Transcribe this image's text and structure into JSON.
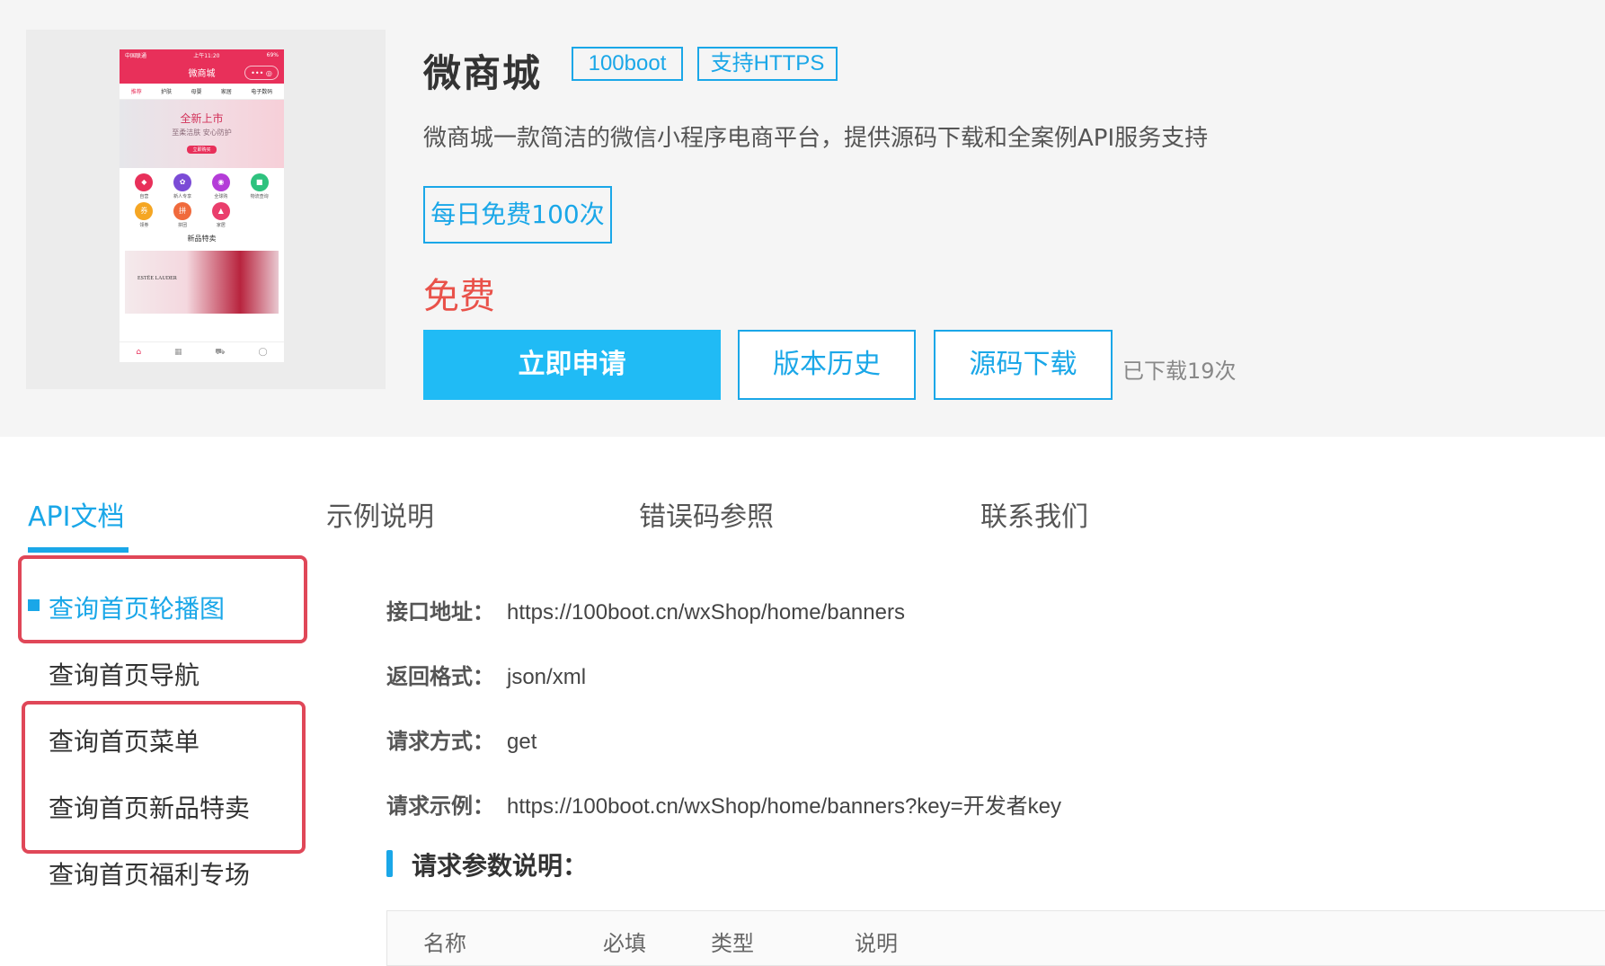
{
  "app": {
    "title": "微商城",
    "tags": [
      "100boot",
      "支持HTTPS"
    ],
    "description": "微商城一款简洁的微信小程序电商平台，提供源码下载和全案例API服务支持",
    "quota": "每日免费100次",
    "price": "免费",
    "download_count": "已下载19次"
  },
  "buttons": {
    "apply": "立即申请",
    "history": "版本历史",
    "download": "源码下载"
  },
  "thumbnail": {
    "status_left": "中国联通",
    "status_time": "上午11:20",
    "status_right": "69%",
    "bar_title": "微商城",
    "capsule": "••• ◎",
    "tabs": [
      "推荐",
      "护肤",
      "母婴",
      "家居",
      "电子数码"
    ],
    "banner_title": "全新上市",
    "banner_sub": "至柔洁肤 安心防护",
    "banner_btn": "立即购买",
    "icons": [
      {
        "label": "自营",
        "glyph": "◆",
        "color": "#e8305a"
      },
      {
        "label": "新人专享",
        "glyph": "✿",
        "color": "#7b4bd6"
      },
      {
        "label": "全球购",
        "glyph": "◉",
        "color": "#b43cd8"
      },
      {
        "label": "物流查询",
        "glyph": "■",
        "color": "#2ec27e"
      },
      {
        "label": "领券",
        "glyph": "券",
        "color": "#f5a623"
      },
      {
        "label": "拼团",
        "glyph": "拼",
        "color": "#f06a3c"
      },
      {
        "label": "家居",
        "glyph": "▲",
        "color": "#ea3e6c"
      }
    ],
    "section": "新品特卖",
    "promo_brand": "ESTĒE LAUDER",
    "nav": [
      "⌂",
      "▦",
      "⛟",
      "◯"
    ]
  },
  "tabs": [
    "API文档",
    "示例说明",
    "错误码参照",
    "联系我们"
  ],
  "sidebar": {
    "items": [
      "查询首页轮播图",
      "查询首页导航",
      "查询首页菜单",
      "查询首页新品特卖",
      "查询首页福利专场"
    ]
  },
  "api": {
    "rows": [
      {
        "label": "接口地址：",
        "value": "https://100boot.cn/wxShop/home/banners"
      },
      {
        "label": "返回格式：",
        "value": "json/xml"
      },
      {
        "label": "请求方式：",
        "value": "get"
      },
      {
        "label": "请求示例：",
        "value": "https://100boot.cn/wxShop/home/banners?key=开发者key"
      }
    ],
    "params_title": "请求参数说明：",
    "table_headers": [
      "名称",
      "必填",
      "类型",
      "说明"
    ]
  },
  "colors": {
    "accent": "#1aa7e8",
    "button": "#20bbf5",
    "price": "#e9524a",
    "highlight": "#e04758"
  }
}
